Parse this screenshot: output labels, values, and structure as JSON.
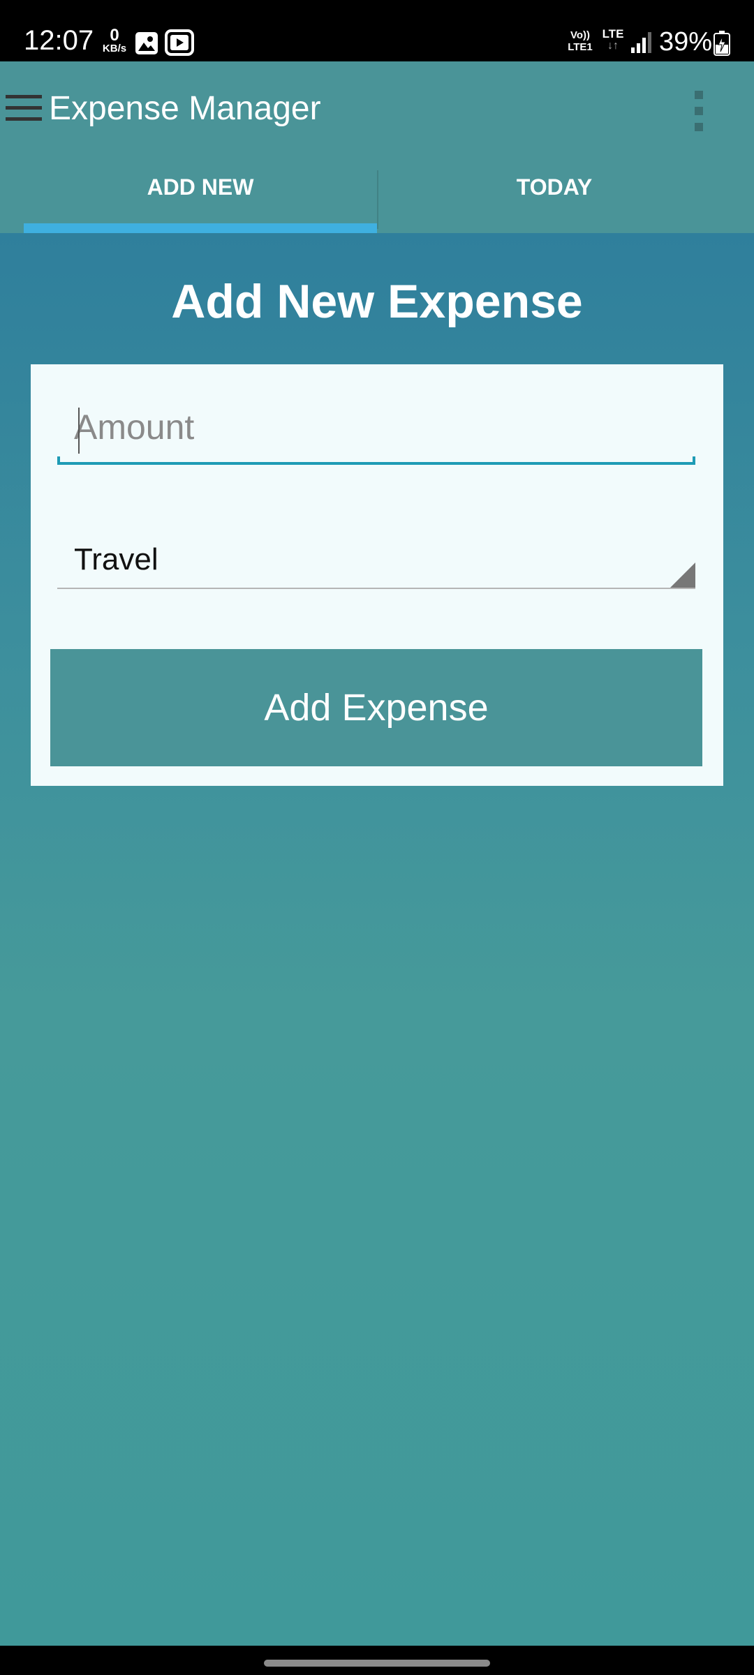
{
  "status_bar": {
    "time": "12:07",
    "net_speed_value": "0",
    "net_speed_unit": "KB/s",
    "volte_line1": "Vo))",
    "volte_line2": "LTE1",
    "network_type": "LTE",
    "battery_percent": "39%",
    "icons": [
      "photo-icon",
      "youtube-icon",
      "signal-icon",
      "battery-charging-icon"
    ]
  },
  "app_bar": {
    "title": "Expense Manager",
    "menu_icon": "hamburger-menu-icon",
    "overflow_icon": "more-vert-icon"
  },
  "tabs": [
    {
      "label": "ADD NEW",
      "selected": true
    },
    {
      "label": "TODAY",
      "selected": false
    }
  ],
  "form": {
    "heading": "Add New Expense",
    "amount_placeholder": "Amount",
    "amount_value": "",
    "category_selected": "Travel",
    "submit_label": "Add Expense"
  },
  "colors": {
    "app_bar": "#4a9498",
    "tab_indicator": "#3fb0e0",
    "input_focus": "#1e9bb5",
    "button": "#4a9498",
    "card_background": "#f2fbfc"
  }
}
